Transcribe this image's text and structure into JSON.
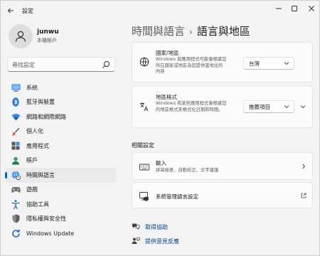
{
  "app": {
    "title": "設定"
  },
  "user": {
    "name": "junwu",
    "subtitle": "本機帳戶"
  },
  "search": {
    "placeholder": "尋找設定"
  },
  "sidebar": {
    "items": [
      {
        "label": "系統",
        "icon": "monitor-icon",
        "active": false
      },
      {
        "label": "藍牙與裝置",
        "icon": "bluetooth-icon",
        "active": false
      },
      {
        "label": "網路和網際網路",
        "icon": "wifi-icon",
        "active": false
      },
      {
        "label": "個人化",
        "icon": "brush-icon",
        "active": false
      },
      {
        "label": "應用程式",
        "icon": "apps-icon",
        "active": false
      },
      {
        "label": "帳戶",
        "icon": "person-icon",
        "active": false
      },
      {
        "label": "時間與語言",
        "icon": "globe-clock-icon",
        "active": true
      },
      {
        "label": "遊戲",
        "icon": "gamepad-icon",
        "active": false
      },
      {
        "label": "協助工具",
        "icon": "accessibility-icon",
        "active": false
      },
      {
        "label": "隱私權與安全性",
        "icon": "shield-icon",
        "active": false
      },
      {
        "label": "Windows Update",
        "icon": "update-icon",
        "active": false
      }
    ]
  },
  "header": {
    "parent": "時間與語言",
    "separator": "›",
    "current": "語言與地區"
  },
  "region": {
    "country": {
      "title": "國家/地區",
      "desc": "Windows 與應用程式可能會根據您所在國家或地區為您提供當地化的內容",
      "value": "台灣"
    },
    "format": {
      "title": "地區格式",
      "desc": "Windows 和某些應用程式會根據您的地區格式來格式化日期和時間。",
      "value": "推薦項目"
    }
  },
  "related": {
    "title": "相關設定",
    "typing": {
      "title": "輸入",
      "desc": "拼寫檢查、自動校正、文字建議"
    },
    "admin": {
      "title": "系統管理語言設定"
    }
  },
  "links": {
    "help": "取得協助",
    "feedback": "提供意見反應"
  },
  "colors": {
    "accent": "#0067c0",
    "link": "#003e92",
    "background": "#f3f3f3"
  }
}
